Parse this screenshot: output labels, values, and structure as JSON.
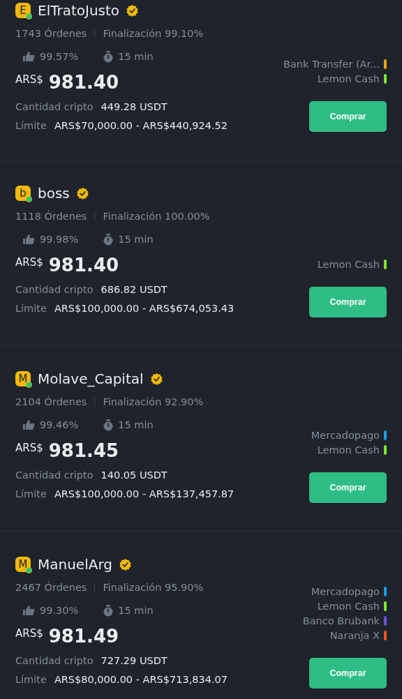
{
  "offers": [
    {
      "avatar_letter": "E",
      "online": true,
      "name": "ElTratoJusto",
      "verified": true,
      "orders": "1743 Órdenes",
      "completion": "Finalización 99.10%",
      "rating": "99.57%",
      "time": "15 min",
      "currency": "ARS$",
      "price": "981.40",
      "crypto_label": "Cantidad cripto",
      "crypto_amount": "449.28 USDT",
      "limit_label": "Límite",
      "limit": "ARS$70,000.00 - ARS$440,924.52",
      "payments": [
        {
          "name": "Bank Transfer (Ar...",
          "color": "#f0a30a"
        },
        {
          "name": "Lemon Cash",
          "color": "#7fea2b"
        }
      ],
      "button": "Comprar"
    },
    {
      "avatar_letter": "b",
      "online": true,
      "name": "boss",
      "verified": true,
      "orders": "1118 Órdenes",
      "completion": "Finalización 100.00%",
      "rating": "99.98%",
      "time": "15 min",
      "currency": "ARS$",
      "price": "981.40",
      "crypto_label": "Cantidad cripto",
      "crypto_amount": "686.82 USDT",
      "limit_label": "Límite",
      "limit": "ARS$100,000.00 - ARS$674,053.43",
      "payments": [
        {
          "name": "Lemon Cash",
          "color": "#7fea2b"
        }
      ],
      "button": "Comprar"
    },
    {
      "avatar_letter": "M",
      "online": true,
      "name": "Molave_Capital",
      "verified": true,
      "orders": "2104 Órdenes",
      "completion": "Finalización 92.90%",
      "rating": "99.46%",
      "time": "15 min",
      "currency": "ARS$",
      "price": "981.45",
      "crypto_label": "Cantidad cripto",
      "crypto_amount": "140.05 USDT",
      "limit_label": "Límite",
      "limit": "ARS$100,000.00 - ARS$137,457.87",
      "payments": [
        {
          "name": "Mercadopago",
          "color": "#1e9be8"
        },
        {
          "name": "Lemon Cash",
          "color": "#7fea2b"
        }
      ],
      "button": "Comprar"
    },
    {
      "avatar_letter": "M",
      "online": true,
      "name": "ManuelArg",
      "verified": true,
      "orders": "2467 Órdenes",
      "completion": "Finalización 95.90%",
      "rating": "99.30%",
      "time": "15 min",
      "currency": "ARS$",
      "price": "981.49",
      "crypto_label": "Cantidad cripto",
      "crypto_amount": "727.29 USDT",
      "limit_label": "Límite",
      "limit": "ARS$80,000.00 - ARS$713,834.07",
      "payments": [
        {
          "name": "Mercadopago",
          "color": "#1e9be8"
        },
        {
          "name": "Lemon Cash",
          "color": "#7fea2b"
        },
        {
          "name": "Banco Brubank",
          "color": "#6a4ee0"
        },
        {
          "name": "Naranja X",
          "color": "#f5551e"
        }
      ],
      "button": "Comprar"
    }
  ]
}
